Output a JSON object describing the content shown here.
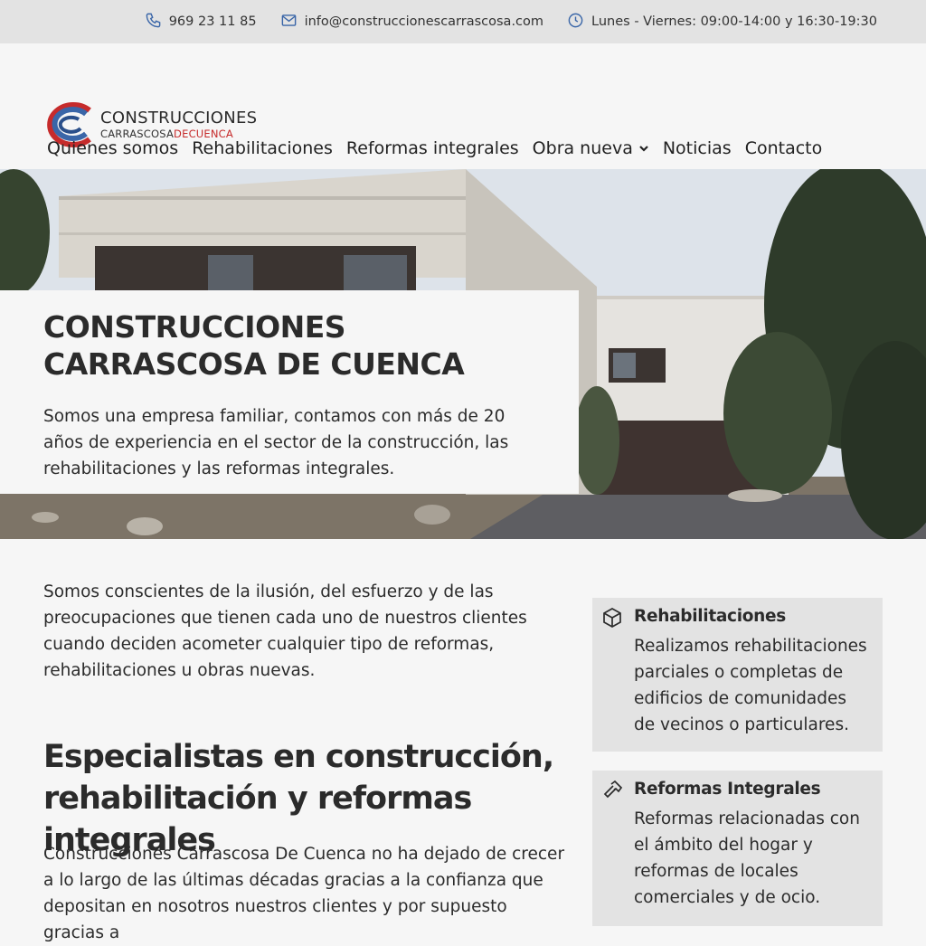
{
  "topbar": {
    "phone": "969 23 11 85",
    "email": "info@construccionescarrascosa.com",
    "hours": "Lunes - Viernes: 09:00-14:00 y 16:30-19:30"
  },
  "logo": {
    "line1": "CONSTRUCCIONES",
    "line2a": "CARRASCOSA",
    "line2b": "DECUENCA"
  },
  "nav": {
    "items": [
      "Quienes somos",
      "Rehabilitaciones",
      "Reformas integrales",
      "Obra nueva",
      "Noticias",
      "Contacto"
    ]
  },
  "hero": {
    "title_line1": "CONSTRUCCIONES",
    "title_line2": "CARRASCOSA DE CUENCA",
    "text": "Somos una empresa familiar, contamos con más de 20 años de experiencia en el sector de la construcción, las rehabilitaciones y las reformas integrales."
  },
  "main": {
    "intro": "Somos conscientes de la ilusión, del esfuerzo y de las preocupaciones que tienen cada uno de nuestros clientes cuando deciden acometer cualquier tipo de reformas, rehabilitaciones u obras nuevas.",
    "heading": "Especialistas en construcción, rehabilitación y reformas integrales",
    "para2": "Construcciones Carrascosa De Cuenca no ha dejado de crecer a lo largo de las últimas décadas gracias a la confianza que depositan en nosotros nuestros clientes y por supuesto gracias a"
  },
  "cards": [
    {
      "title": "Rehabilitaciones",
      "text": "Realizamos rehabilitaciones parciales o completas de edificios de comunidades de vecinos o particulares.",
      "icon": "box-icon"
    },
    {
      "title": "Reformas Integrales",
      "text": "Reformas relacionadas con el ámbito del hogar y reformas de locales comerciales y de ocio.",
      "icon": "hammer-icon"
    }
  ],
  "colors": {
    "accent_blue": "#3a66a8",
    "accent_red": "#c62b2b",
    "topbar_bg": "#e3e3e3",
    "page_bg": "#f6f6f6"
  }
}
